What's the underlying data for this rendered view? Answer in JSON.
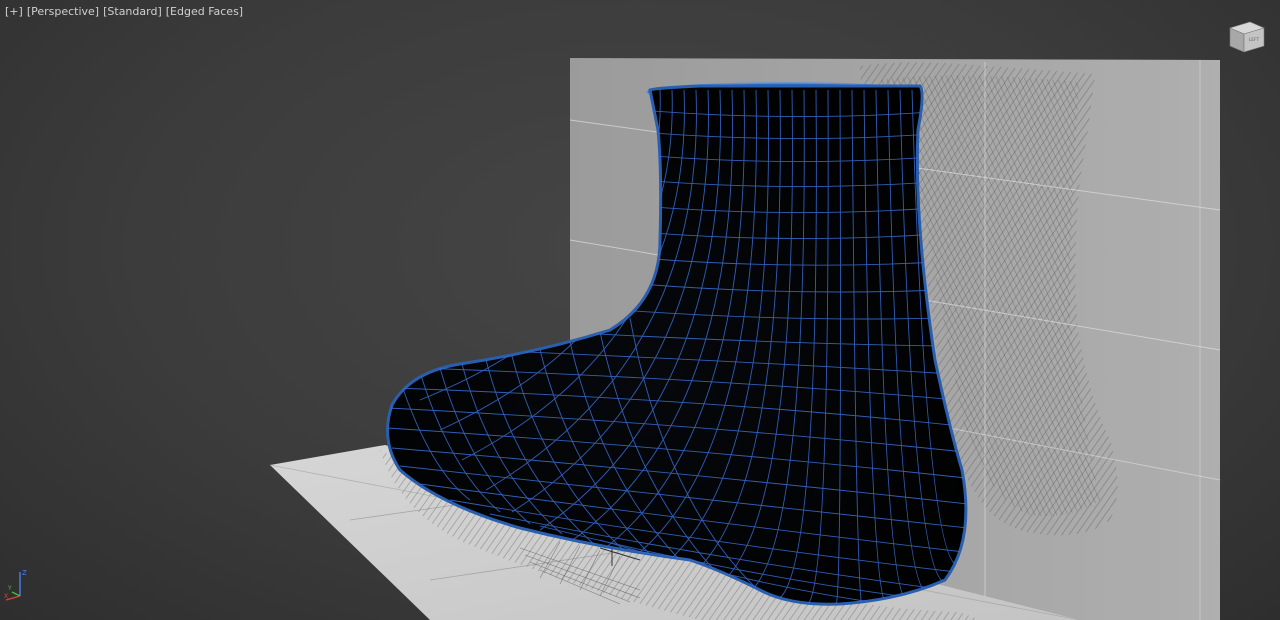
{
  "viewport": {
    "label_parts": [
      "[+]",
      "[Perspective]",
      "[Standard]",
      "[Edged Faces]"
    ],
    "viewcube_face": "LEFT",
    "axis_labels": {
      "z": "Z",
      "x": "X",
      "y": "Y"
    },
    "colors": {
      "background": "#3a3a3a",
      "mesh_body": "#000000",
      "mesh_wire": "#3a6fd8",
      "mesh_rim": "#2a5fb0",
      "reference_plane": "#c8c8c8"
    }
  }
}
